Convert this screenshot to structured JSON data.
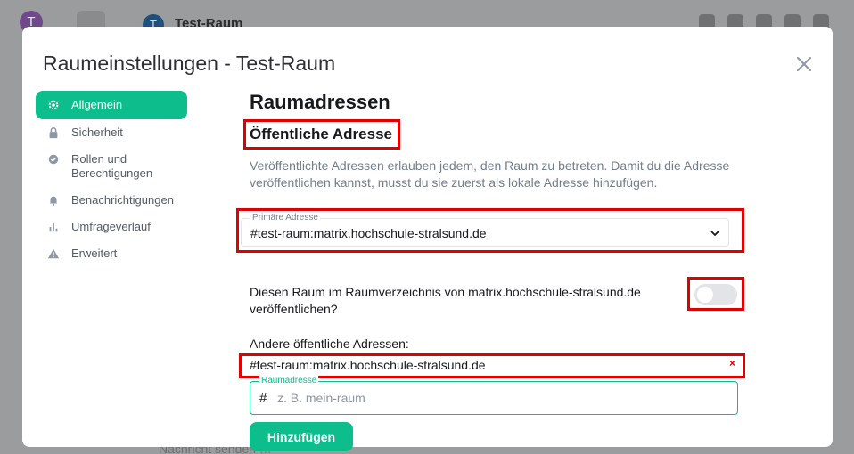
{
  "background": {
    "user_initial": "T",
    "room_initial": "T",
    "room_name": "Test-Raum",
    "composer_placeholder": "Nachricht senden …"
  },
  "dialog": {
    "title": "Raumeinstellungen - Test-Raum",
    "close_icon": "close-icon"
  },
  "sidebar": {
    "items": [
      {
        "label": "Allgemein",
        "icon": "gear-icon",
        "active": true
      },
      {
        "label": "Sicherheit",
        "icon": "lock-icon",
        "active": false
      },
      {
        "label": "Rollen und Berechtigungen",
        "icon": "badge-check-icon",
        "active": false
      },
      {
        "label": "Benachrichtigungen",
        "icon": "bell-icon",
        "active": false
      },
      {
        "label": "Umfrageverlauf",
        "icon": "bar-chart-icon",
        "active": false
      },
      {
        "label": "Erweitert",
        "icon": "warning-icon",
        "active": false
      }
    ]
  },
  "main": {
    "section_title": "Raumadressen",
    "public_address": {
      "title": "Öffentliche Adresse",
      "description": "Veröffentlichte Adressen erlauben jedem, den Raum zu betreten. Damit du die Adresse veröffentlichen kannst, musst du sie zuerst als lokale Adresse hinzufügen.",
      "primary_label": "Primäre Adresse",
      "primary_value": "#test-raum:matrix.hochschule-stralsund.de",
      "publish_text": "Diesen Raum im Raumverzeichnis von matrix.hochschule-stralsund.de veröffentlichen?",
      "publish_enabled": false,
      "other_label": "Andere öffentliche Adressen:",
      "other_aliases": [
        "#test-raum:matrix.hochschule-stralsund.de"
      ],
      "remove_symbol": "×",
      "new_alias_label": "Raumadresse",
      "new_alias_prefix": "#",
      "new_alias_placeholder": "z. B. mein-raum",
      "add_button": "Hinzufügen"
    }
  },
  "colors": {
    "accent": "#0dbd8b",
    "highlight": "#e00000",
    "muted_text": "#737d8c"
  }
}
